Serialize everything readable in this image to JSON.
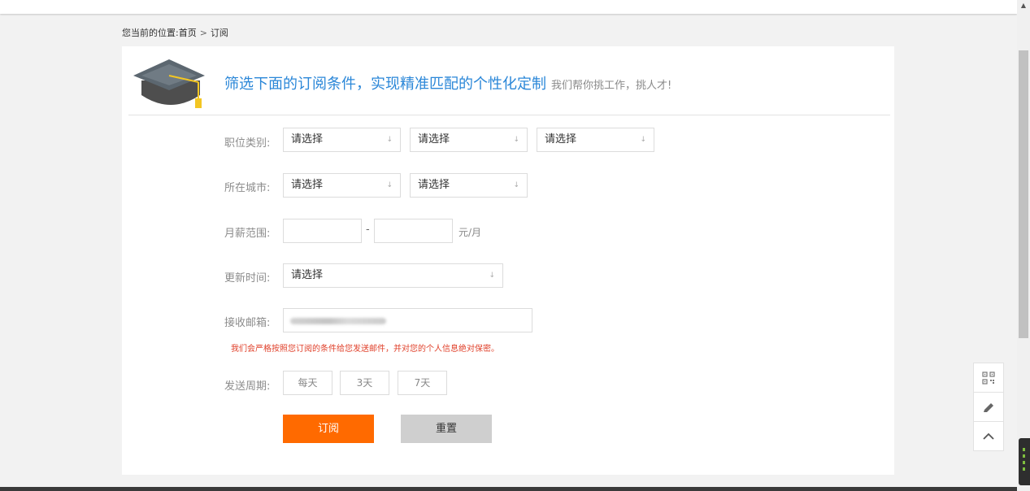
{
  "breadcrumb": {
    "prefix": "您当前的位置:",
    "home": "首页",
    "separator": ">",
    "current": "订阅"
  },
  "header": {
    "icon": "graduation-cap-icon",
    "title": "筛选下面的订阅条件，实现精准匹配的个性化定制",
    "subtitle": "我们帮你挑工作，挑人才!"
  },
  "form": {
    "job_category": {
      "label": "职位类别:",
      "selects": [
        "请选择",
        "请选择",
        "请选择"
      ]
    },
    "city": {
      "label": "所在城市:",
      "selects": [
        "请选择",
        "请选择"
      ]
    },
    "salary": {
      "label": "月薪范围:",
      "min_value": "",
      "max_value": "",
      "separator": "-",
      "unit": "元/月"
    },
    "update_time": {
      "label": "更新时间:",
      "select": "请选择"
    },
    "email": {
      "label": "接收邮箱:",
      "value": ""
    },
    "privacy_note": "我们会严格按照您订阅的条件给您发送邮件，并对您的个人信息绝对保密。",
    "frequency": {
      "label": "发送周期:",
      "options": [
        "每天",
        "3天",
        "7天"
      ]
    },
    "subscribe_label": "订阅",
    "reset_label": "重置"
  },
  "side_tools": [
    "qr-code-icon",
    "edit-icon",
    "back-to-top-icon"
  ],
  "colors": {
    "accent_blue": "#2b87d8",
    "primary_orange": "#ff6a00",
    "note_red": "#e0412b",
    "reset_gray": "#cfcfcf"
  }
}
